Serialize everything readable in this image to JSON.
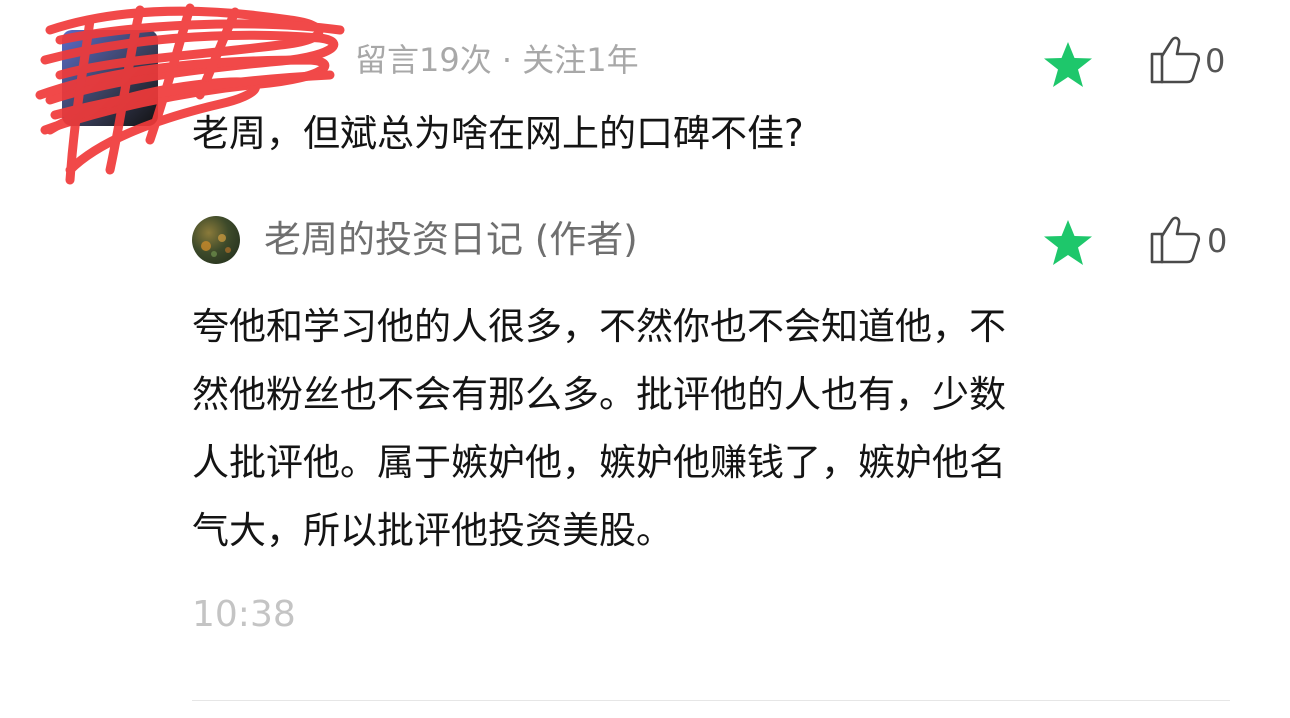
{
  "comment": {
    "meta": "留言19次 · 关注1年",
    "text": "老周，但斌总为啥在网上的口碑不佳?",
    "like_count": "0",
    "star_icon": "star-icon",
    "like_icon": "thumbs-up-icon"
  },
  "reply": {
    "author_name": "老周的投资日记 (作者)",
    "lines": [
      "夸他和学习他的人很多，不然你也不会知道他，不",
      "然他粉丝也不会有那么多。批评他的人也有，少数",
      "人批评他。属于嫉妒他，嫉妒他赚钱了，嫉妒他名",
      "气大，所以批评他投资美股。"
    ],
    "like_count": "0",
    "timestamp": "10:38"
  },
  "colors": {
    "star_green": "#1ec76b",
    "meta_gray": "#a8a8a8",
    "author_gray": "#6f6f6f",
    "timestamp_gray": "#c4c4c4",
    "redaction_red": "#f03a3a"
  }
}
